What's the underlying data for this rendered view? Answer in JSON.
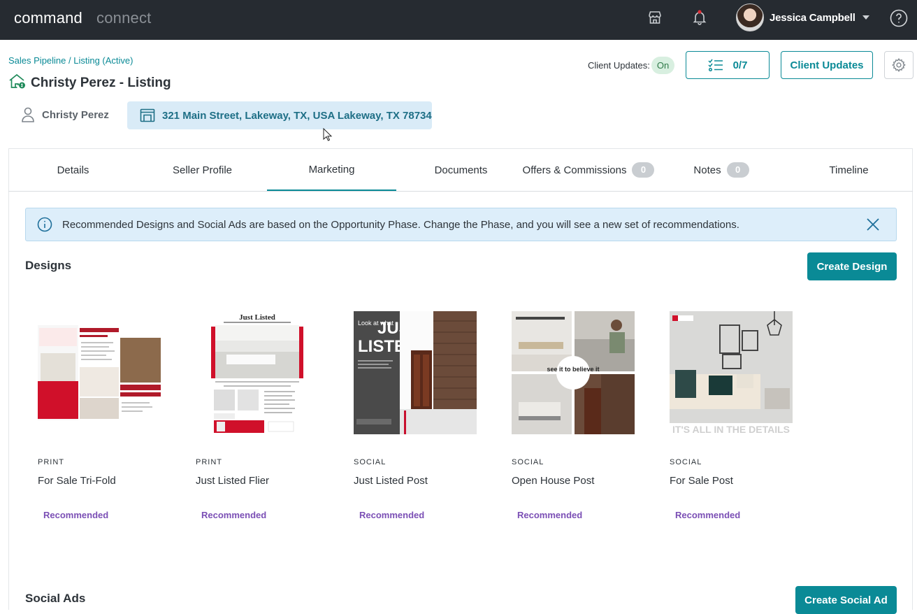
{
  "topbar": {
    "brand_primary": "command",
    "brand_secondary": "connect",
    "store_icon": "store-icon",
    "bell_icon": "bell-icon",
    "user_name": "Jessica Campbell",
    "help_icon": "help-circle-icon"
  },
  "header": {
    "breadcrumb_pipeline": "Sales Pipeline",
    "breadcrumb_sep": " / ",
    "breadcrumb_listing": "Listing (Active)",
    "title": "Christy Perez - Listing",
    "client_updates_label": "Client Updates:",
    "client_updates_state": "On",
    "tasks_count": "0/7",
    "client_updates_button": "Client Updates",
    "contact_name": "Christy Perez",
    "address": "321 Main Street, Lakeway, TX, USA Lakeway, TX 78734"
  },
  "tabs": [
    {
      "label": "Details"
    },
    {
      "label": "Seller Profile"
    },
    {
      "label": "Marketing",
      "active": true
    },
    {
      "label": "Documents"
    },
    {
      "label": "Offers & Commissions",
      "badge": "0"
    },
    {
      "label": "Notes",
      "badge": "0"
    },
    {
      "label": "Timeline"
    }
  ],
  "info_banner": {
    "text": "Recommended Designs and Social Ads are based on the Opportunity Phase. Change the Phase, and you will see a new set of recommendations."
  },
  "designs": {
    "title": "Designs",
    "create_button": "Create Design",
    "items": [
      {
        "kind": "PRINT",
        "name": "For Sale Tri-Fold",
        "tag": "Recommended"
      },
      {
        "kind": "PRINT",
        "name": "Just Listed Flier",
        "tag": "Recommended"
      },
      {
        "kind": "SOCIAL",
        "name": "Just Listed Post",
        "tag": "Recommended"
      },
      {
        "kind": "SOCIAL",
        "name": "Open House Post",
        "tag": "Recommended"
      },
      {
        "kind": "SOCIAL",
        "name": "For Sale Post",
        "tag": "Recommended"
      }
    ]
  },
  "thumb_text": {
    "just_listed": "Just Listed",
    "look_at_what": "Look at what",
    "just": "JUST",
    "listed": "LISTED",
    "see_it": "see it to believe it",
    "details": "IT'S ALL IN THE DETAILS"
  },
  "social_ads": {
    "title": "Social Ads",
    "create_button": "Create Social Ad"
  },
  "colors": {
    "topbar": "#262b31",
    "accent": "#0a8a96",
    "recommended": "#7b4fb5",
    "info_bg": "#ddeefa"
  }
}
